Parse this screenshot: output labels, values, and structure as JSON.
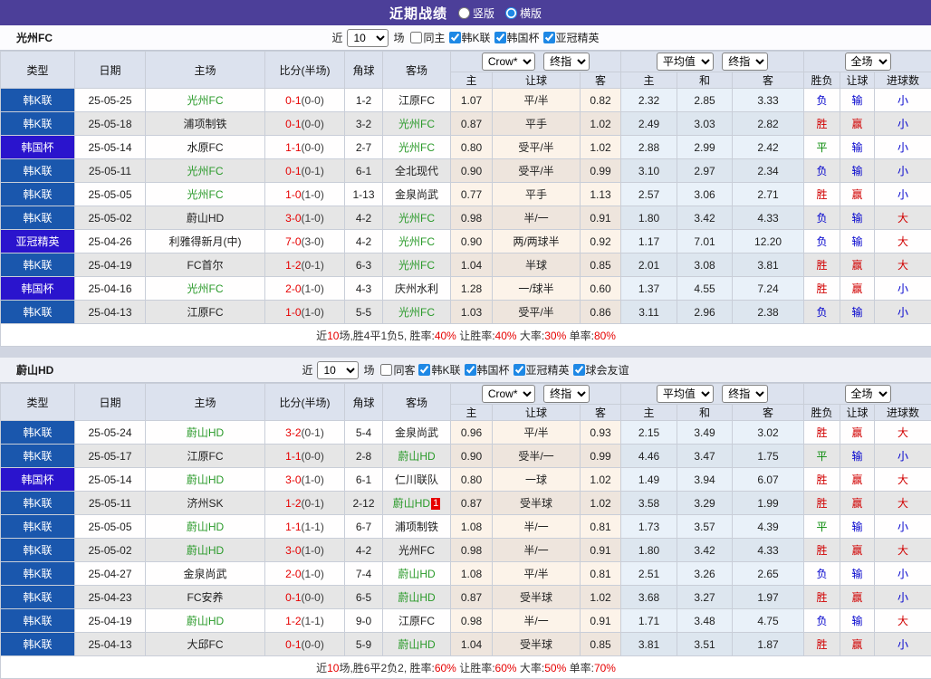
{
  "titlebar": {
    "title": "近期战绩",
    "radios": [
      {
        "label": "竖版",
        "checked": false
      },
      {
        "label": "横版",
        "checked": true
      }
    ]
  },
  "colors": {
    "titlebar_bg": "#4c3f99",
    "type_colors": {
      "韩K联": "#1a57ad",
      "韩国杯": "#2a14cd",
      "亚冠精英": "#2a14cd"
    },
    "result_colors": {
      "胜": "#d10000",
      "平": "#0a8a0a",
      "负": "#0000cd",
      "赢": "#d10000",
      "输": "#0000cd",
      "大": "#d10000",
      "小": "#0000cd"
    },
    "highlight_team": "#2a9a2a",
    "score": "#e60000"
  },
  "sections": [
    {
      "team": "光州FC",
      "filter": {
        "near_label": "近",
        "games": "10",
        "games_label": "场",
        "checkboxes": [
          {
            "label": "同主",
            "checked": false
          },
          {
            "label": "韩K联",
            "checked": true
          },
          {
            "label": "韩国杯",
            "checked": true
          },
          {
            "label": "亚冠精英",
            "checked": true
          }
        ]
      },
      "header": {
        "static_cols": [
          "类型",
          "日期",
          "主场",
          "比分(半场)",
          "角球",
          "客场"
        ],
        "odds_selects": [
          "Crow*",
          "终指"
        ],
        "odds_cols": [
          "主",
          "让球",
          "客"
        ],
        "avg_selects": [
          "平均值",
          "终指"
        ],
        "avg_cols": [
          "主",
          "和",
          "客"
        ],
        "result_select": "全场",
        "result_cols": [
          "胜负",
          "让球",
          "进球数"
        ]
      },
      "rows": [
        {
          "type": "韩K联",
          "date": "25-05-25",
          "home": "光州FC",
          "home_hl": true,
          "score": "0-1",
          "half": "(0-0)",
          "corner": "1-2",
          "away": "江原FC",
          "away_hl": false,
          "oh": "1.07",
          "hc": "平/半",
          "oa": "0.82",
          "ah": "2.32",
          "ad": "2.85",
          "aa": "3.33",
          "r": "负",
          "hr": "输",
          "gr": "小"
        },
        {
          "type": "韩K联",
          "date": "25-05-18",
          "home": "浦项制铁",
          "home_hl": false,
          "score": "0-1",
          "half": "(0-0)",
          "corner": "3-2",
          "away": "光州FC",
          "away_hl": true,
          "oh": "0.87",
          "hc": "平手",
          "oa": "1.02",
          "ah": "2.49",
          "ad": "3.03",
          "aa": "2.82",
          "r": "胜",
          "hr": "赢",
          "gr": "小"
        },
        {
          "type": "韩国杯",
          "date": "25-05-14",
          "home": "水原FC",
          "home_hl": false,
          "score": "1-1",
          "half": "(0-0)",
          "corner": "2-7",
          "away": "光州FC",
          "away_hl": true,
          "oh": "0.80",
          "hc": "受平/半",
          "oa": "1.02",
          "ah": "2.88",
          "ad": "2.99",
          "aa": "2.42",
          "r": "平",
          "hr": "输",
          "gr": "小"
        },
        {
          "type": "韩K联",
          "date": "25-05-11",
          "home": "光州FC",
          "home_hl": true,
          "score": "0-1",
          "half": "(0-1)",
          "corner": "6-1",
          "away": "全北现代",
          "away_hl": false,
          "oh": "0.90",
          "hc": "受平/半",
          "oa": "0.99",
          "ah": "3.10",
          "ad": "2.97",
          "aa": "2.34",
          "r": "负",
          "hr": "输",
          "gr": "小"
        },
        {
          "type": "韩K联",
          "date": "25-05-05",
          "home": "光州FC",
          "home_hl": true,
          "score": "1-0",
          "half": "(1-0)",
          "corner": "1-13",
          "away": "金泉尚武",
          "away_hl": false,
          "oh": "0.77",
          "hc": "平手",
          "oa": "1.13",
          "ah": "2.57",
          "ad": "3.06",
          "aa": "2.71",
          "r": "胜",
          "hr": "赢",
          "gr": "小"
        },
        {
          "type": "韩K联",
          "date": "25-05-02",
          "home": "蔚山HD",
          "home_hl": false,
          "score": "3-0",
          "half": "(1-0)",
          "corner": "4-2",
          "away": "光州FC",
          "away_hl": true,
          "oh": "0.98",
          "hc": "半/一",
          "oa": "0.91",
          "ah": "1.80",
          "ad": "3.42",
          "aa": "4.33",
          "r": "负",
          "hr": "输",
          "gr": "大"
        },
        {
          "type": "亚冠精英",
          "date": "25-04-26",
          "home": "利雅得新月(中)",
          "home_hl": false,
          "score": "7-0",
          "half": "(3-0)",
          "corner": "4-2",
          "away": "光州FC",
          "away_hl": true,
          "oh": "0.90",
          "hc": "两/两球半",
          "oa": "0.92",
          "ah": "1.17",
          "ad": "7.01",
          "aa": "12.20",
          "r": "负",
          "hr": "输",
          "gr": "大"
        },
        {
          "type": "韩K联",
          "date": "25-04-19",
          "home": "FC首尔",
          "home_hl": false,
          "score": "1-2",
          "half": "(0-1)",
          "corner": "6-3",
          "away": "光州FC",
          "away_hl": true,
          "oh": "1.04",
          "hc": "半球",
          "oa": "0.85",
          "ah": "2.01",
          "ad": "3.08",
          "aa": "3.81",
          "r": "胜",
          "hr": "赢",
          "gr": "大"
        },
        {
          "type": "韩国杯",
          "date": "25-04-16",
          "home": "光州FC",
          "home_hl": true,
          "score": "2-0",
          "half": "(1-0)",
          "corner": "4-3",
          "away": "庆州水利",
          "away_hl": false,
          "oh": "1.28",
          "hc": "一/球半",
          "oa": "0.60",
          "ah": "1.37",
          "ad": "4.55",
          "aa": "7.24",
          "r": "胜",
          "hr": "赢",
          "gr": "小"
        },
        {
          "type": "韩K联",
          "date": "25-04-13",
          "home": "江原FC",
          "home_hl": false,
          "score": "1-0",
          "half": "(1-0)",
          "corner": "5-5",
          "away": "光州FC",
          "away_hl": true,
          "oh": "1.03",
          "hc": "受平/半",
          "oa": "0.86",
          "ah": "3.11",
          "ad": "2.96",
          "aa": "2.38",
          "r": "负",
          "hr": "输",
          "gr": "小"
        }
      ],
      "summary": [
        {
          "t": "近",
          "red": false
        },
        {
          "t": "10",
          "red": true
        },
        {
          "t": "场,胜4平1负5, 胜率:",
          "red": false
        },
        {
          "t": "40%",
          "red": true
        },
        {
          "t": " 让胜率:",
          "red": false
        },
        {
          "t": "40%",
          "red": true
        },
        {
          "t": " 大率:",
          "red": false
        },
        {
          "t": "30%",
          "red": true
        },
        {
          "t": " 单率:",
          "red": false
        },
        {
          "t": "80%",
          "red": true
        }
      ]
    },
    {
      "team": "蔚山HD",
      "filter": {
        "near_label": "近",
        "games": "10",
        "games_label": "场",
        "checkboxes": [
          {
            "label": "同客",
            "checked": false
          },
          {
            "label": "韩K联",
            "checked": true
          },
          {
            "label": "韩国杯",
            "checked": true
          },
          {
            "label": "亚冠精英",
            "checked": true
          },
          {
            "label": "球会友谊",
            "checked": true
          }
        ]
      },
      "header": {
        "static_cols": [
          "类型",
          "日期",
          "主场",
          "比分(半场)",
          "角球",
          "客场"
        ],
        "odds_selects": [
          "Crow*",
          "终指"
        ],
        "odds_cols": [
          "主",
          "让球",
          "客"
        ],
        "avg_selects": [
          "平均值",
          "终指"
        ],
        "avg_cols": [
          "主",
          "和",
          "客"
        ],
        "result_select": "全场",
        "result_cols": [
          "胜负",
          "让球",
          "进球数"
        ]
      },
      "rows": [
        {
          "type": "韩K联",
          "date": "25-05-24",
          "home": "蔚山HD",
          "home_hl": true,
          "score": "3-2",
          "half": "(0-1)",
          "corner": "5-4",
          "away": "金泉尚武",
          "away_hl": false,
          "oh": "0.96",
          "hc": "平/半",
          "oa": "0.93",
          "ah": "2.15",
          "ad": "3.49",
          "aa": "3.02",
          "r": "胜",
          "hr": "赢",
          "gr": "大"
        },
        {
          "type": "韩K联",
          "date": "25-05-17",
          "home": "江原FC",
          "home_hl": false,
          "score": "1-1",
          "half": "(0-0)",
          "corner": "2-8",
          "away": "蔚山HD",
          "away_hl": true,
          "oh": "0.90",
          "hc": "受半/一",
          "oa": "0.99",
          "ah": "4.46",
          "ad": "3.47",
          "aa": "1.75",
          "r": "平",
          "hr": "输",
          "gr": "小"
        },
        {
          "type": "韩国杯",
          "date": "25-05-14",
          "home": "蔚山HD",
          "home_hl": true,
          "score": "3-0",
          "half": "(1-0)",
          "corner": "6-1",
          "away": "仁川联队",
          "away_hl": false,
          "oh": "0.80",
          "hc": "一球",
          "oa": "1.02",
          "ah": "1.49",
          "ad": "3.94",
          "aa": "6.07",
          "r": "胜",
          "hr": "赢",
          "gr": "大"
        },
        {
          "type": "韩K联",
          "date": "25-05-11",
          "home": "济州SK",
          "home_hl": false,
          "score": "1-2",
          "half": "(0-1)",
          "corner": "2-12",
          "away": "蔚山HD",
          "away_hl": true,
          "away_badge": "1",
          "oh": "0.87",
          "hc": "受半球",
          "oa": "1.02",
          "ah": "3.58",
          "ad": "3.29",
          "aa": "1.99",
          "r": "胜",
          "hr": "赢",
          "gr": "大"
        },
        {
          "type": "韩K联",
          "date": "25-05-05",
          "home": "蔚山HD",
          "home_hl": true,
          "score": "1-1",
          "half": "(1-1)",
          "corner": "6-7",
          "away": "浦项制铁",
          "away_hl": false,
          "oh": "1.08",
          "hc": "半/一",
          "oa": "0.81",
          "ah": "1.73",
          "ad": "3.57",
          "aa": "4.39",
          "r": "平",
          "hr": "输",
          "gr": "小"
        },
        {
          "type": "韩K联",
          "date": "25-05-02",
          "home": "蔚山HD",
          "home_hl": true,
          "score": "3-0",
          "half": "(1-0)",
          "corner": "4-2",
          "away": "光州FC",
          "away_hl": false,
          "oh": "0.98",
          "hc": "半/一",
          "oa": "0.91",
          "ah": "1.80",
          "ad": "3.42",
          "aa": "4.33",
          "r": "胜",
          "hr": "赢",
          "gr": "大"
        },
        {
          "type": "韩K联",
          "date": "25-04-27",
          "home": "金泉尚武",
          "home_hl": false,
          "score": "2-0",
          "half": "(1-0)",
          "corner": "7-4",
          "away": "蔚山HD",
          "away_hl": true,
          "oh": "1.08",
          "hc": "平/半",
          "oa": "0.81",
          "ah": "2.51",
          "ad": "3.26",
          "aa": "2.65",
          "r": "负",
          "hr": "输",
          "gr": "小"
        },
        {
          "type": "韩K联",
          "date": "25-04-23",
          "home": "FC安养",
          "home_hl": false,
          "score": "0-1",
          "half": "(0-0)",
          "corner": "6-5",
          "away": "蔚山HD",
          "away_hl": true,
          "oh": "0.87",
          "hc": "受半球",
          "oa": "1.02",
          "ah": "3.68",
          "ad": "3.27",
          "aa": "1.97",
          "r": "胜",
          "hr": "赢",
          "gr": "小"
        },
        {
          "type": "韩K联",
          "date": "25-04-19",
          "home": "蔚山HD",
          "home_hl": true,
          "score": "1-2",
          "half": "(1-1)",
          "corner": "9-0",
          "away": "江原FC",
          "away_hl": false,
          "oh": "0.98",
          "hc": "半/一",
          "oa": "0.91",
          "ah": "1.71",
          "ad": "3.48",
          "aa": "4.75",
          "r": "负",
          "hr": "输",
          "gr": "大"
        },
        {
          "type": "韩K联",
          "date": "25-04-13",
          "home": "大邱FC",
          "home_hl": false,
          "score": "0-1",
          "half": "(0-0)",
          "corner": "5-9",
          "away": "蔚山HD",
          "away_hl": true,
          "oh": "1.04",
          "hc": "受半球",
          "oa": "0.85",
          "ah": "3.81",
          "ad": "3.51",
          "aa": "1.87",
          "r": "胜",
          "hr": "赢",
          "gr": "小"
        }
      ],
      "summary": [
        {
          "t": "近",
          "red": false
        },
        {
          "t": "10",
          "red": true
        },
        {
          "t": "场,胜6平2负2, 胜率:",
          "red": false
        },
        {
          "t": "60%",
          "red": true
        },
        {
          "t": " 让胜率:",
          "red": false
        },
        {
          "t": "60%",
          "red": true
        },
        {
          "t": " 大率:",
          "red": false
        },
        {
          "t": "50%",
          "red": true
        },
        {
          "t": " 单率:",
          "red": false
        },
        {
          "t": "70%",
          "red": true
        }
      ]
    }
  ]
}
